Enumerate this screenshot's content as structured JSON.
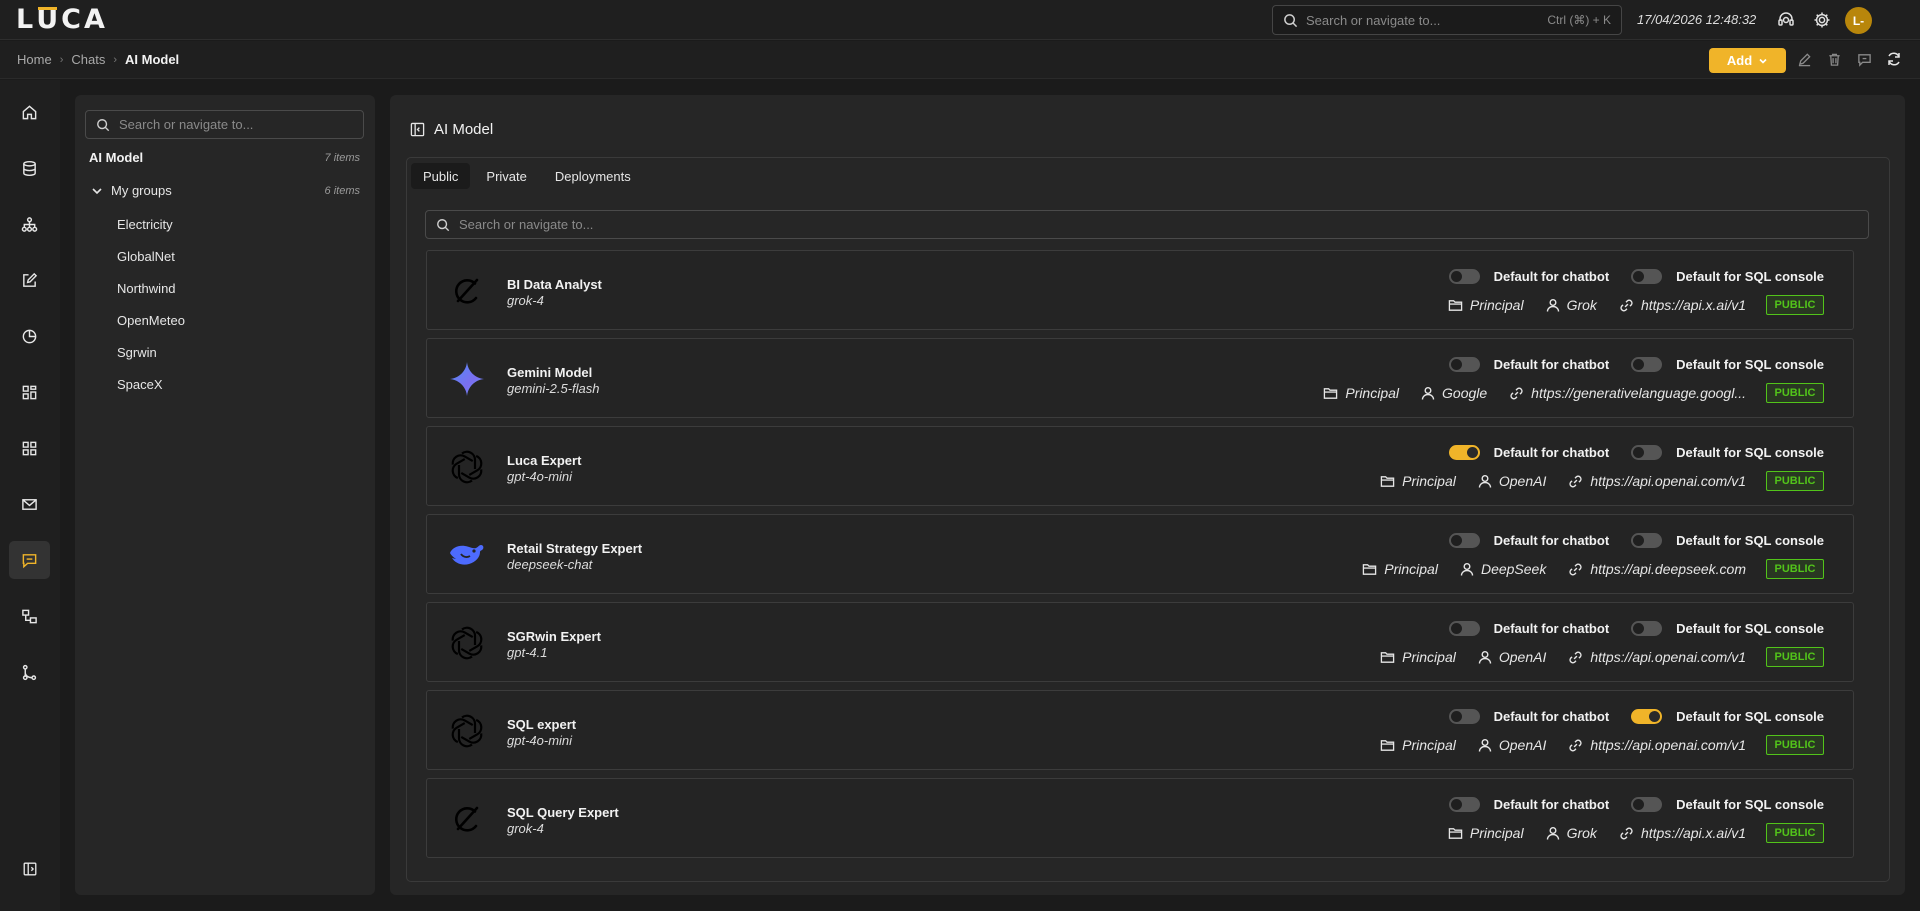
{
  "app": {
    "logo": "LUCA"
  },
  "topbar": {
    "search_placeholder": "Search or navigate to...",
    "shortcut": "Ctrl (⌘) + K",
    "datetime": "17/04/2026 12:48:32",
    "avatar": "L-"
  },
  "breadcrumb": {
    "home": "Home",
    "chats": "Chats",
    "current": "AI Model"
  },
  "toolbar": {
    "add_label": "Add"
  },
  "tree": {
    "search_placeholder": "Search or navigate to...",
    "root_label": "AI Model",
    "root_count": "7 items",
    "group_label": "My groups",
    "group_count": "6 items",
    "items": [
      "Electricity",
      "GlobalNet",
      "Northwind",
      "OpenMeteo",
      "Sgrwin",
      "SpaceX"
    ]
  },
  "main": {
    "title": "AI Model",
    "tabs": [
      "Public",
      "Private",
      "Deployments"
    ],
    "search_placeholder": "Search or navigate to...",
    "toggle_chatbot_label": "Default for chatbot",
    "toggle_sql_label": "Default for SQL console",
    "models": [
      {
        "name": "BI Data Analyst",
        "model": "grok-4",
        "logo": "grok-icon",
        "chatbot_default": false,
        "sql_default": false,
        "folder": "Principal",
        "provider": "Grok",
        "url": "https://api.x.ai/v1",
        "badge": "PUBLIC"
      },
      {
        "name": "Gemini Model",
        "model": "gemini-2.5-flash",
        "logo": "gemini-icon",
        "chatbot_default": false,
        "sql_default": false,
        "folder": "Principal",
        "provider": "Google",
        "url": "https://generativelanguage.googl...",
        "badge": "PUBLIC"
      },
      {
        "name": "Luca Expert",
        "model": "gpt-4o-mini",
        "logo": "openai-icon",
        "chatbot_default": true,
        "sql_default": false,
        "folder": "Principal",
        "provider": "OpenAI",
        "url": "https://api.openai.com/v1",
        "badge": "PUBLIC"
      },
      {
        "name": "Retail Strategy Expert",
        "model": "deepseek-chat",
        "logo": "deepseek-icon",
        "chatbot_default": false,
        "sql_default": false,
        "folder": "Principal",
        "provider": "DeepSeek",
        "url": "https://api.deepseek.com",
        "badge": "PUBLIC"
      },
      {
        "name": "SGRwin Expert",
        "model": "gpt-4.1",
        "logo": "openai-icon",
        "chatbot_default": false,
        "sql_default": false,
        "folder": "Principal",
        "provider": "OpenAI",
        "url": "https://api.openai.com/v1",
        "badge": "PUBLIC"
      },
      {
        "name": "SQL expert",
        "model": "gpt-4o-mini",
        "logo": "openai-icon",
        "chatbot_default": false,
        "sql_default": true,
        "folder": "Principal",
        "provider": "OpenAI",
        "url": "https://api.openai.com/v1",
        "badge": "PUBLIC"
      },
      {
        "name": "SQL Query Expert",
        "model": "grok-4",
        "logo": "grok-icon",
        "chatbot_default": false,
        "sql_default": false,
        "folder": "Principal",
        "provider": "Grok",
        "url": "https://api.x.ai/v1",
        "badge": "PUBLIC"
      }
    ]
  },
  "colors": {
    "accent": "#f0b429",
    "public_badge": "#52c41a",
    "deepseek": "#4d6bfe"
  }
}
